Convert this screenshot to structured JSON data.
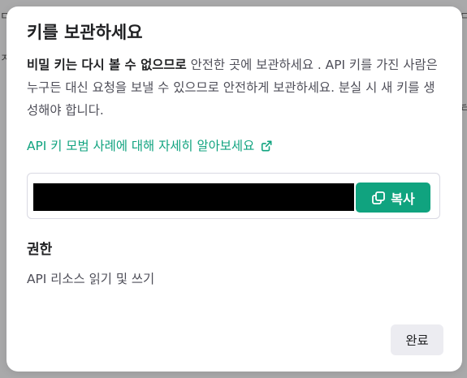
{
  "background_peek": {
    "top_left": "ㅁ",
    "top_right": "ㄷ",
    "mid_left": "ㅈ",
    "mid_right": "님"
  },
  "modal": {
    "title": "키를 보관하세요",
    "description_bold": "비밀 키는 다시 볼 수 없으므로",
    "description_rest": " 안전한 곳에 보관하세요 . API 키를 가진 사람은 누구든 대신 요청을 보낼 수 있으므로 안전하게 보관하세요. 분실 시 새 키를 생성해야 합니다.",
    "docs_link_label": "API 키 모범 사례에 대해 자세히 알아보세요",
    "key_value": "",
    "copy_label": "복사",
    "permissions_heading": "권한",
    "permissions_value": "API 리소스 읽기 및 쓰기",
    "done_label": "완료"
  },
  "colors": {
    "accent": "#10a37f",
    "overlay": "#a9a9aa",
    "key_mask": "#000000",
    "secondary_button": "#ececf1"
  },
  "icons": {
    "external_link": "external-link-icon",
    "copy": "copy-icon"
  }
}
